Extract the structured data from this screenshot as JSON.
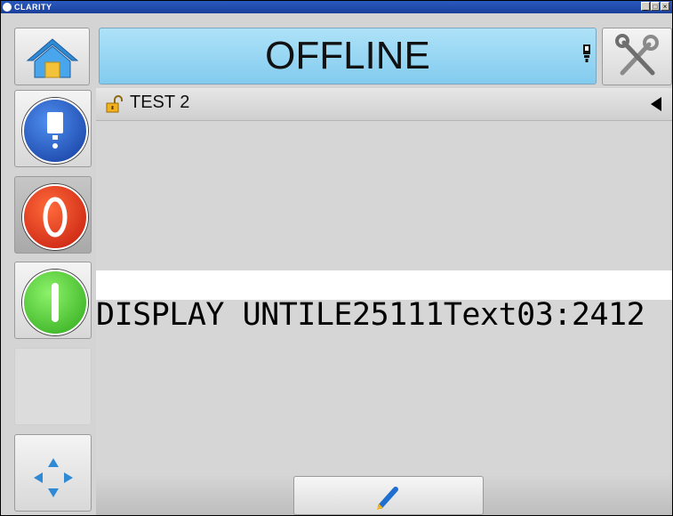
{
  "window": {
    "title": "CLARITY",
    "min_label": "_",
    "max_label": "□",
    "close_label": "×"
  },
  "header": {
    "status_text": "OFFLINE",
    "status_color": "#9ad8f4"
  },
  "job": {
    "name": "TEST 2",
    "lock_icon": "unlocked-padlock-icon"
  },
  "message": {
    "text": "DISPLAY UNTILE25111Text03:2412"
  },
  "icons": {
    "home": "home-icon",
    "tools": "tools-icon",
    "ink": "ink-cartridge-icon",
    "info": "info-ink-icon",
    "stop": "stop-icon",
    "start": "start-icon",
    "nav": "navigation-arrows-icon",
    "edit": "pencil-icon"
  }
}
